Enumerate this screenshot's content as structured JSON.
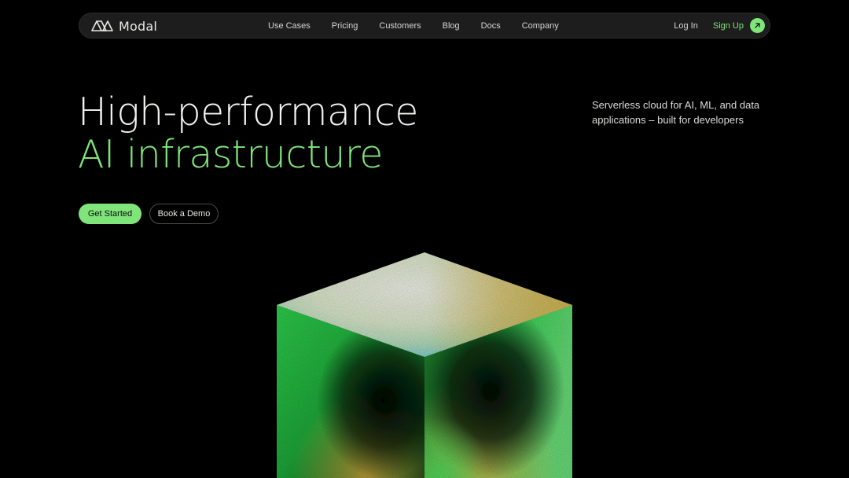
{
  "nav": {
    "brand": "Modal",
    "links": [
      "Use Cases",
      "Pricing",
      "Customers",
      "Blog",
      "Docs",
      "Company"
    ],
    "login": "Log In",
    "signup": "Sign Up",
    "signup_icon": "arrow-up-right-icon"
  },
  "hero": {
    "title_line1": "High-performance",
    "title_line2": "AI infrastructure",
    "tagline": "Serverless cloud for AI, ML, and data applications – built for developers",
    "primary_cta": "Get Started",
    "secondary_cta": "Book a Demo"
  },
  "colors": {
    "background": "#000000",
    "accent": "#7fe57a",
    "nav_bg": "#1c1d1c",
    "text": "#f2f2f0"
  },
  "illustration": {
    "name": "gradient-cube",
    "palette": [
      "#2fd34f",
      "#8fe5a0",
      "#e8ecd8",
      "#5fc8d8",
      "#d9b64a",
      "#000000"
    ]
  }
}
